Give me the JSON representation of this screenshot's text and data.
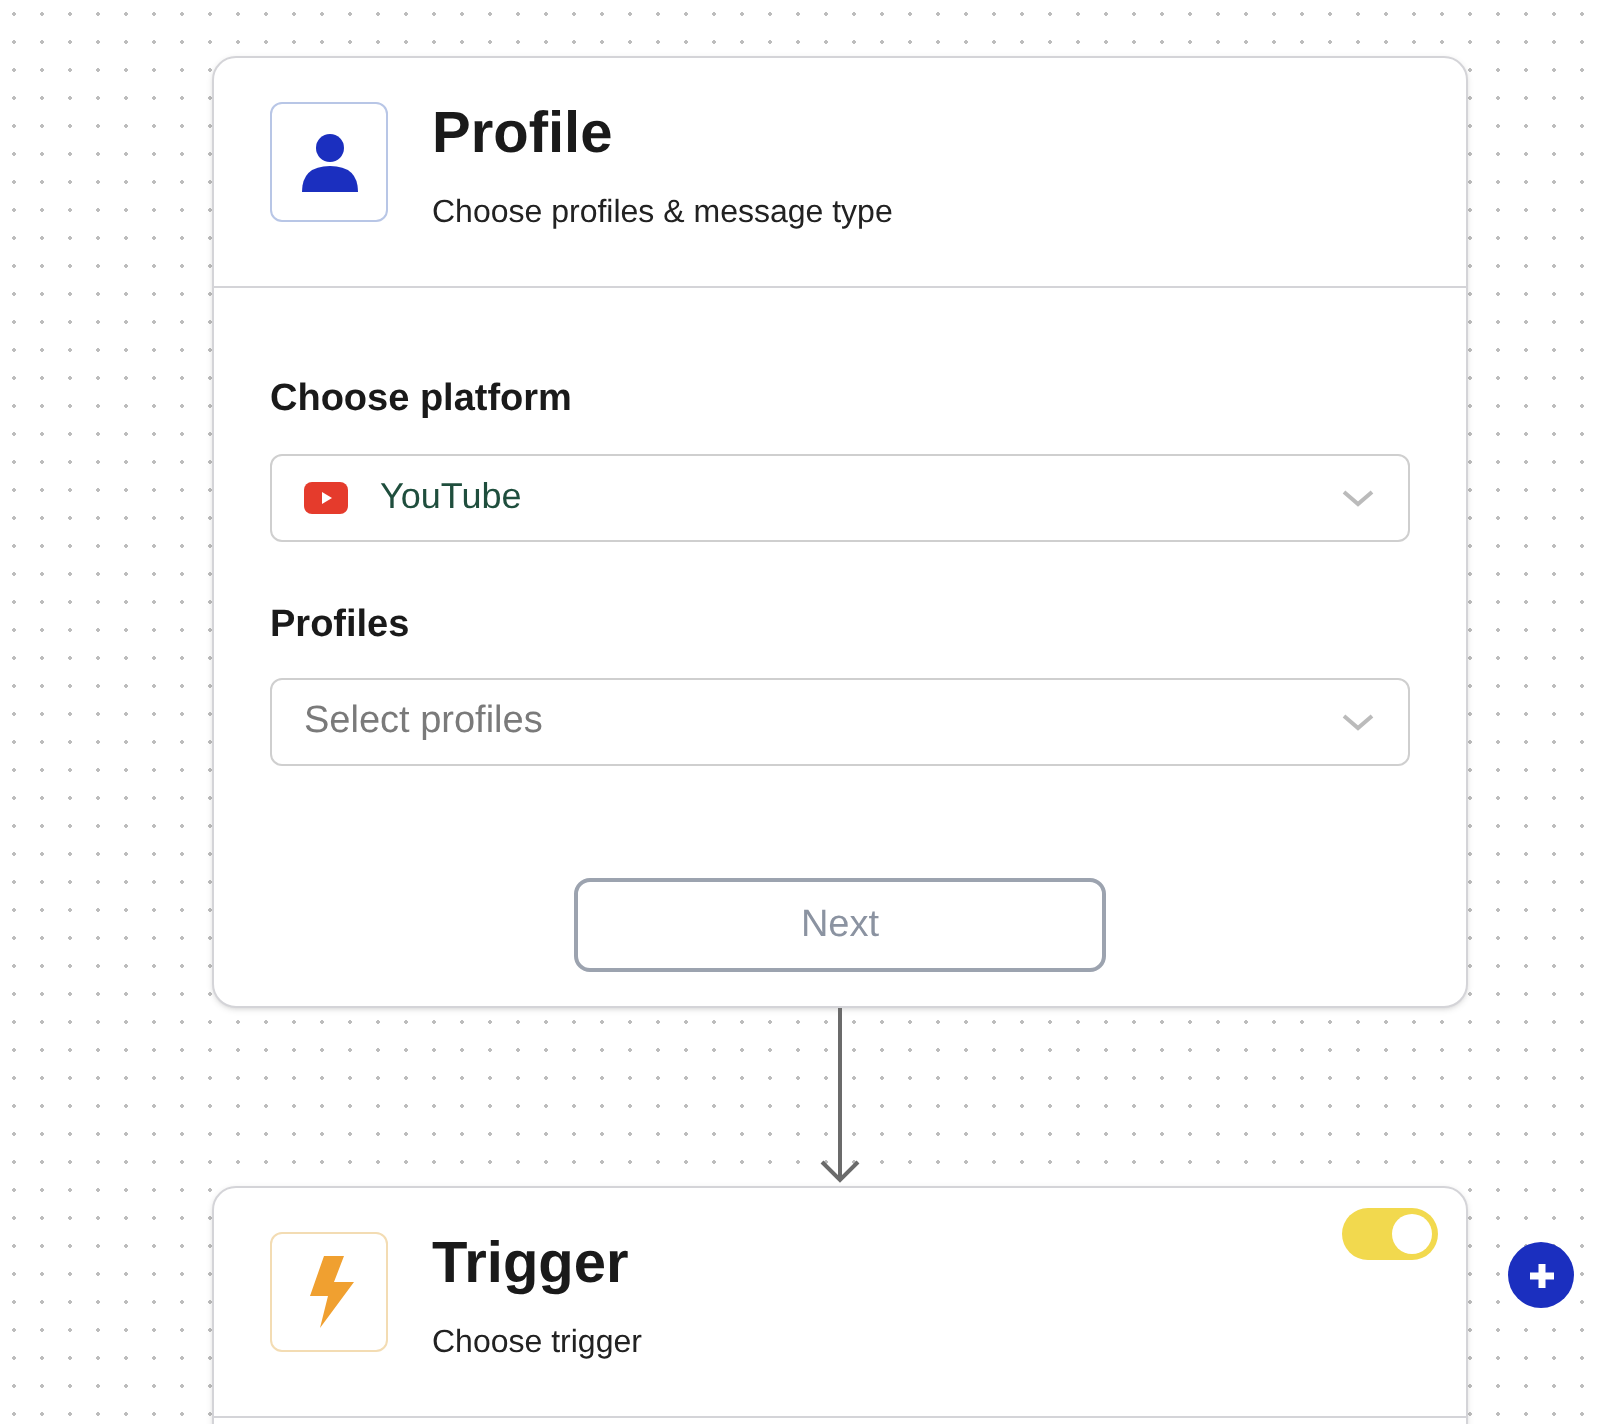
{
  "nodes": [
    {
      "kind": "profile",
      "title": "Profile",
      "subtitle": "Choose profiles & message type",
      "fields": [
        {
          "kind": "platform",
          "label": "Choose platform",
          "value": "YouTube"
        },
        {
          "kind": "select",
          "label": "Profiles",
          "placeholder": "Select profiles"
        }
      ],
      "button": "Next"
    },
    {
      "kind": "trigger",
      "title": "Trigger",
      "subtitle": "Choose trigger",
      "on": true
    }
  ]
}
